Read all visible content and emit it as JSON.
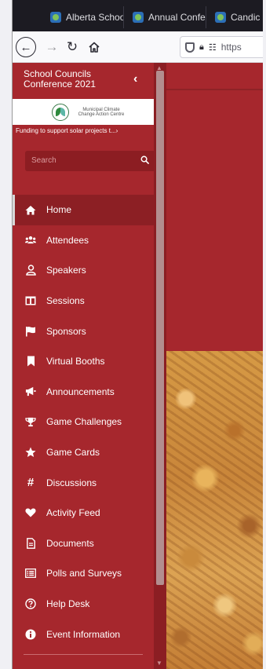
{
  "browser": {
    "tabs": [
      {
        "title": "Alberta Schoo",
        "icon": "site-favicon"
      },
      {
        "title": "Annual Confe",
        "icon": "site-favicon"
      },
      {
        "title": "Candic",
        "icon": "site-favicon"
      }
    ],
    "url_text": "https"
  },
  "sidebar": {
    "title": "School Councils Conference 2021",
    "sponsor": {
      "logo_text": "Municipal Climate Change Action Centre",
      "caption": "Funding to support solar projects t...›"
    },
    "search": {
      "placeholder": "Search"
    },
    "items": [
      {
        "label": "Home",
        "icon": "home-icon",
        "active": true
      },
      {
        "label": "Attendees",
        "icon": "users-icon"
      },
      {
        "label": "Speakers",
        "icon": "user-icon"
      },
      {
        "label": "Sessions",
        "icon": "columns-icon"
      },
      {
        "label": "Sponsors",
        "icon": "flag-icon"
      },
      {
        "label": "Virtual Booths",
        "icon": "bookmark-icon"
      },
      {
        "label": "Announcements",
        "icon": "megaphone-icon"
      },
      {
        "label": "Game Challenges",
        "icon": "trophy-icon"
      },
      {
        "label": "Game Cards",
        "icon": "star-icon"
      },
      {
        "label": "Discussions",
        "icon": "hashtag-icon"
      },
      {
        "label": "Activity Feed",
        "icon": "heart-icon"
      },
      {
        "label": "Documents",
        "icon": "document-icon"
      },
      {
        "label": "Polls and Surveys",
        "icon": "list-icon"
      },
      {
        "label": "Help Desk",
        "icon": "question-circle-icon"
      },
      {
        "label": "Event Information",
        "icon": "info-circle-icon"
      }
    ]
  },
  "colors": {
    "brand_red": "#a6272d",
    "active_item": "#8c1f24",
    "search_bg": "#8c1d22"
  }
}
